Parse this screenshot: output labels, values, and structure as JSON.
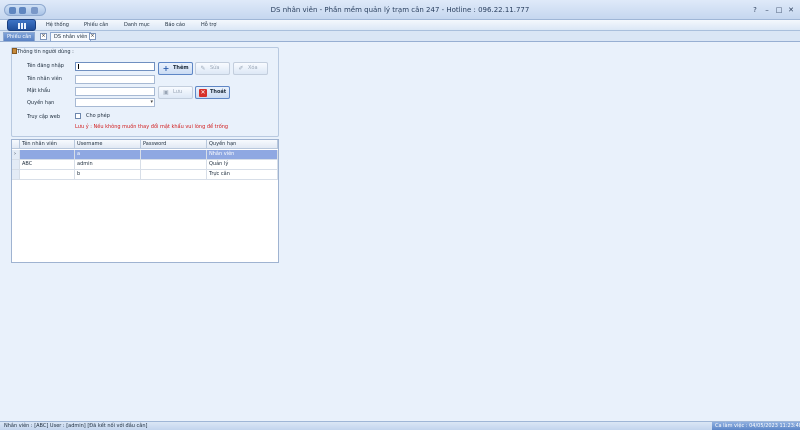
{
  "window": {
    "title": "DS nhân viên - Phần mềm quản lý trạm cân 247 - Hotline : 096.22.11.777",
    "controls": [
      "?",
      "–",
      "□",
      "✕"
    ]
  },
  "ribbon": {
    "tabs": [
      "Hệ thống",
      "Phiếu cân",
      "Danh mục",
      "Báo cáo",
      "Hỗ trợ"
    ]
  },
  "doc_tabs": [
    {
      "label": "Phiếu cân",
      "active": false
    },
    {
      "label": "DS nhân viên",
      "active": true
    }
  ],
  "form": {
    "group_title": "Thông tin người dùng :",
    "labels": {
      "username": "Tên đăng nhập",
      "employee_name": "Tên nhân viên",
      "password": "Mật khẩu",
      "role": "Quyền hạn",
      "web_access": "Truy cập web"
    },
    "values": {
      "username": "",
      "employee_name": "",
      "password": "",
      "role": ""
    },
    "checkbox_label": "Cho phép",
    "checkbox_checked": false,
    "note": "Lưu ý : Nếu không muốn thay đổi mật khẩu vui lòng để trống"
  },
  "buttons": {
    "add": {
      "label": "Thêm",
      "icon": "plus-icon",
      "enabled": true
    },
    "edit": {
      "label": "Sửa",
      "icon": "pencil-icon",
      "enabled": false
    },
    "delete": {
      "label": "Xóa",
      "icon": "eraser-icon",
      "enabled": false
    },
    "save": {
      "label": "Lưu",
      "icon": "save-icon",
      "enabled": false
    },
    "exit": {
      "label": "Thoát",
      "icon": "close-icon",
      "enabled": true
    }
  },
  "grid": {
    "columns": [
      "Tên nhân viên",
      "Username",
      "Password",
      "Quyền hạn"
    ],
    "rows": [
      {
        "name": "",
        "username": "a",
        "password": "",
        "role": "Nhân viên",
        "selected": true,
        "indicator": "›"
      },
      {
        "name": "ABC",
        "username": "admin",
        "password": "",
        "role": "Quản lý",
        "selected": false,
        "indicator": ""
      },
      {
        "name": "",
        "username": "b",
        "password": "",
        "role": "Trực cân",
        "selected": false,
        "indicator": ""
      }
    ]
  },
  "status": {
    "left": "Nhân viên : [ABC]  User : [admin]  [Đã kết nối với đầu cân]",
    "right": "Ca làm việc : 04/05/2023 11:23:48"
  },
  "colors": {
    "accent": "#5a82c4",
    "selected_row": "#8fa8e2",
    "note_text": "#d11a1a"
  }
}
